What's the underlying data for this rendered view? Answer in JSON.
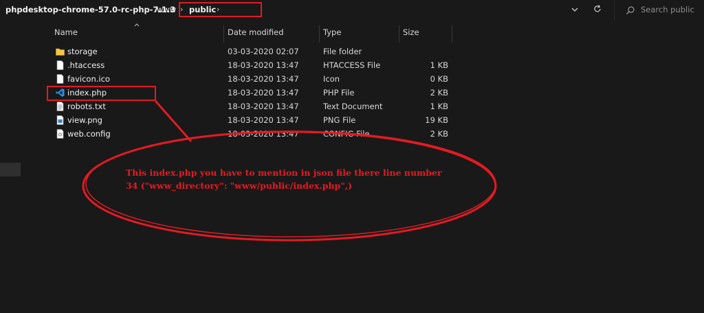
{
  "breadcrumb": {
    "items": [
      "phpdesktop-chrome-57.0-rc-php-7.1.3",
      "www",
      "public"
    ],
    "separator": "›"
  },
  "search": {
    "placeholder": "Search public"
  },
  "columns": {
    "name": "Name",
    "date": "Date modified",
    "type": "Type",
    "size": "Size"
  },
  "files": [
    {
      "name": "storage",
      "date": "03-03-2020 02:07",
      "type": "File folder",
      "size": "",
      "icon": "folder-icon"
    },
    {
      "name": ".htaccess",
      "date": "18-03-2020 13:47",
      "type": "HTACCESS File",
      "size": "1 KB",
      "icon": "file-icon"
    },
    {
      "name": "favicon.ico",
      "date": "18-03-2020 13:47",
      "type": "Icon",
      "size": "0 KB",
      "icon": "file-icon"
    },
    {
      "name": "index.php",
      "date": "18-03-2020 13:47",
      "type": "PHP File",
      "size": "2 KB",
      "icon": "vscode-icon"
    },
    {
      "name": "robots.txt",
      "date": "18-03-2020 13:47",
      "type": "Text Document",
      "size": "1 KB",
      "icon": "text-file-icon"
    },
    {
      "name": "view.png",
      "date": "18-03-2020 13:47",
      "type": "PNG File",
      "size": "19 KB",
      "icon": "image-file-icon"
    },
    {
      "name": "web.config",
      "date": "18-03-2020 13:47",
      "type": "CONFIG File",
      "size": "2 KB",
      "icon": "config-file-icon"
    }
  ],
  "annotation": {
    "text": "This index.php you have to mention in json file there line number 34 (\"www_directory\": \"www/public/index.php\",)",
    "color": "#e31b23"
  },
  "theme": {
    "background": "#191919",
    "highlight": "#e31b23"
  }
}
